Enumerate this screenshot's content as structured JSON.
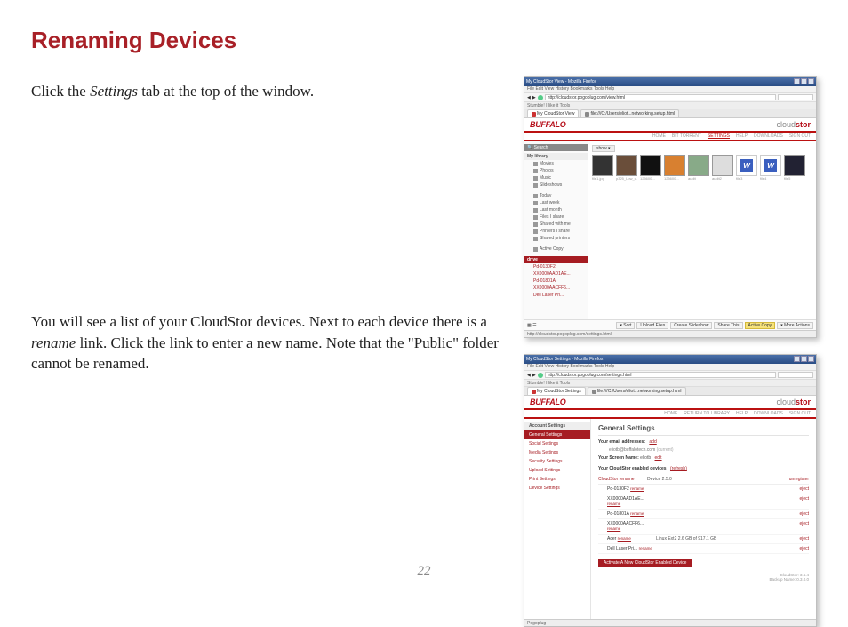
{
  "page": {
    "title": "Renaming Devices",
    "pageNumber": "22"
  },
  "text": {
    "p1a": "Click the ",
    "p1b": "Settings",
    "p1c": " tab at the top of the window.",
    "p2a": "You will see a list of your CloudStor devices. Next to each device there is a ",
    "p2b": "rename",
    "p2c": " link. Click the link to enter a new name. Note that the \"Public\" folder cannot be renamed."
  },
  "shot1": {
    "windowTitle": "My CloudStor View - Mozilla Firefox",
    "menubar": "File  Edit  View  History  Bookmarks  Tools  Help",
    "url": "http://cloudstor.pogoplug.com/view.html",
    "toolbar2": "Stumble!   I like it   Tools",
    "tab1": "My CloudStor View",
    "tab2": "file:///C:/Users/eliot...networking.setup.html",
    "brand1": "BUFFALO",
    "brand2a": "cloud",
    "brand2b": "stor",
    "nav": {
      "home": "HOME",
      "bt": "BIT TORRENT",
      "settings": "SETTINGS",
      "help": "HELP",
      "dl": "DOWNLOADS",
      "so": "SIGN OUT"
    },
    "sidebar": {
      "search": "Search",
      "heading1": "My library",
      "movies": "Movies",
      "photos": "Photos",
      "music": "Music",
      "slideshows": "Slideshows",
      "today": "Today",
      "lastweek": "Last week",
      "lastmonth": "Last month",
      "filesishare": "Files I share",
      "sharedwithme": "Shared with me",
      "printersishare": "Printers I share",
      "sharedprinters": "Shared printers",
      "activecopy": "Active Copy",
      "drives": "drive",
      "d1": "Pd-0130F2",
      "d2": "XX0000AAD1AE...",
      "d3": "Pd-01801A",
      "d4": "XX0000AACFF6...",
      "d5": "Dell Laser Pri..."
    },
    "viewBtn": "show ▾",
    "thumbLabels": [
      "file1.jpg",
      "p325_Low_c...thresurgence037.jpg",
      "125600...",
      "125600...",
      "audit",
      "audit2",
      "file3",
      "file4",
      "file5"
    ],
    "bottombar": {
      "sort": "▾ Sort",
      "upload": "Upload Files",
      "slideshow": "Create Slideshow",
      "share": "Share This",
      "ac": "Active Copy",
      "more": "▾ More Actions"
    },
    "status": "http://cloudstor.pogoplug.com/settings.html"
  },
  "shot2": {
    "windowTitle": "My CloudStor Settings - Mozilla Firefox",
    "url": "http://cloudstor.pogoplug.com/settings.html",
    "tab1": "My CloudStor Settings",
    "tab2": "file:///C:/Users/eliot...networking.setup.html",
    "nav": {
      "home": "HOME",
      "rtl": "RETURN TO LIBRARY",
      "help": "HELP",
      "dl": "DOWNLOADS",
      "so": "SIGN OUT"
    },
    "sidebar": {
      "hdr": "Account Settings",
      "gs": "General Settings",
      "ss": "Social Settings",
      "ms": "Media Settings",
      "sec": "Security Settings",
      "us": "Upload Settings",
      "ps": "Print Settings",
      "ds": "Device Settings"
    },
    "main": {
      "title": "General Settings",
      "emailLabel": "Your email addresses:",
      "emailAdd": "add",
      "emailVal": "eliotb@buffalotech.com",
      "emailCurrent": "(current)",
      "screenNameLabel": "Your Screen Name:",
      "screenNameVal": "eliotb",
      "screenNameEdit": "edit",
      "devicesLabel": "Your CloudStor enabled devices",
      "devicesRefresh": "(refresh)",
      "col1": "CloudStor",
      "col1link": "rename",
      "col2": "Device 2.5.0",
      "col3": "unregister",
      "devices": [
        {
          "name": "Pd-0130F2",
          "rename": "rename",
          "info": "",
          "action": "eject"
        },
        {
          "name": "XX0000AAD1AE...",
          "rename": "rename",
          "info": "",
          "action": "eject"
        },
        {
          "name": "Pd-01801A",
          "rename": "rename",
          "info": "",
          "action": "eject"
        },
        {
          "name": "XX0000AACFF6...",
          "rename": "rename",
          "info": "",
          "action": "eject"
        },
        {
          "name": "Acer",
          "rename": "rename",
          "info": "Linux Ext2          2.6 GB of 917.1 GB",
          "action": "eject"
        },
        {
          "name": "Dell Laser Pri...",
          "rename": "rename",
          "info": "",
          "action": "eject"
        }
      ],
      "activateBtn": "Activate A New CloudStor Enabled Device",
      "footer1": "CloudStor: 3.6.4",
      "footer2": "Backup Name: 0.3.0.0"
    },
    "status": "Pogoplug"
  }
}
